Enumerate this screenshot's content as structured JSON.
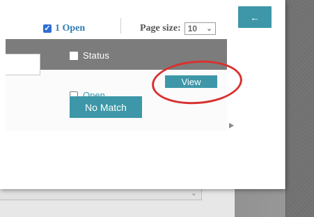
{
  "window": {
    "back_button_label": "←"
  },
  "toolbar": {
    "open_filter_label": "1 Open",
    "page_size_label": "Page size:",
    "page_size_value": "10",
    "page_size_caret": "⌄"
  },
  "table": {
    "headers": {
      "status_label": "Status"
    },
    "rows": [
      {
        "status_option": "Open",
        "action_label": "View"
      }
    ],
    "secondary_action_label": "No Match"
  },
  "lower_panel": {
    "dropdown_caret": "⌄"
  },
  "colors": {
    "accent": "#3d97a8",
    "link": "#2f7db3",
    "annotation": "#d7312f"
  },
  "icons": {
    "back": "arrow-left-icon",
    "checked": "check-icon",
    "dropdown": "chevron-down-icon",
    "scroll": "triangle-right-icon"
  }
}
